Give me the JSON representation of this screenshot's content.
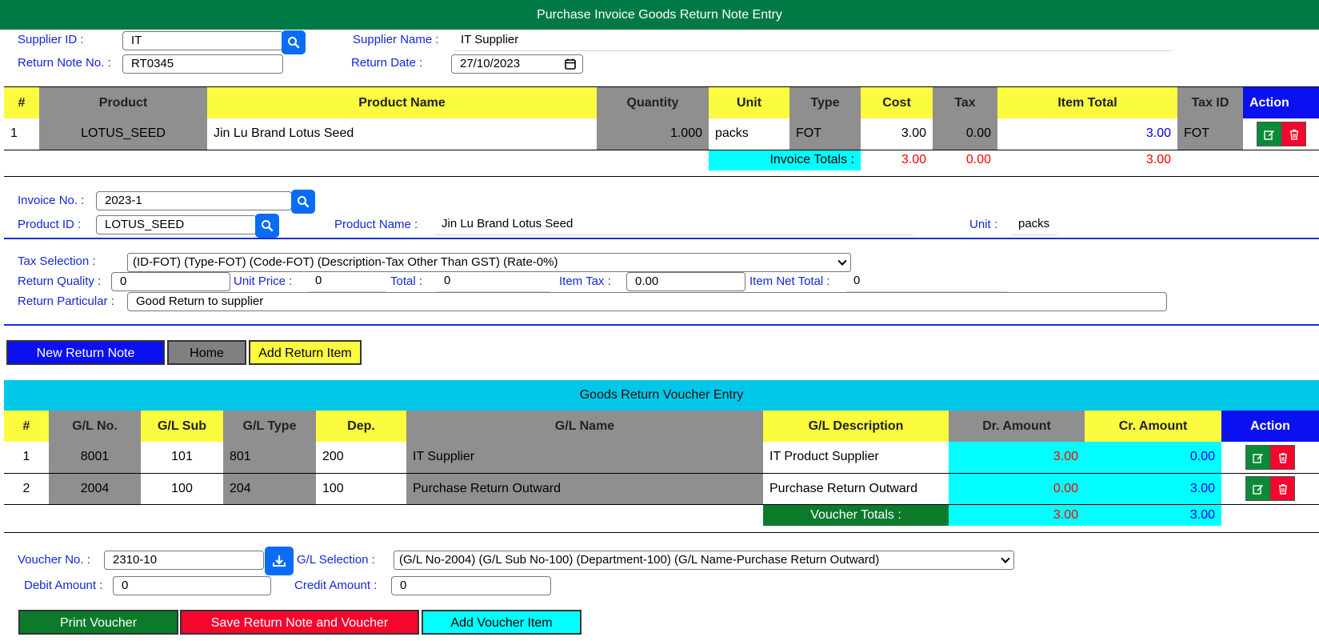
{
  "title": "Purchase Invoice Goods Return Note Entry",
  "header": {
    "supplier_id_label": "Supplier ID :",
    "supplier_id_value": "IT",
    "supplier_name_label": "Supplier Name :",
    "supplier_name_value": "IT Supplier",
    "return_note_label": "Return Note No. :",
    "return_note_value": "RT0345",
    "return_date_label": "Return Date :",
    "return_date_value": "27/10/2023"
  },
  "items_table": {
    "headers": [
      "#",
      "Product",
      "Product Name",
      "Quantity",
      "Unit",
      "Type",
      "Cost",
      "Tax",
      "Item Total",
      "Tax ID",
      "Action"
    ],
    "rows": [
      {
        "no": "1",
        "product": "LOTUS_SEED",
        "product_name": "Jin Lu Brand Lotus Seed",
        "quantity": "1.000",
        "unit": "packs",
        "type": "FOT",
        "cost": "3.00",
        "tax": "0.00",
        "item_total": "3.00",
        "tax_id": "FOT"
      }
    ],
    "totals_label": "Invoice Totals :",
    "total_cost": "3.00",
    "total_tax": "0.00",
    "total_item": "3.00"
  },
  "item_form": {
    "invoice_label": "Invoice No. :",
    "invoice_value": "2023-1",
    "product_id_label": "Product ID :",
    "product_id_value": "LOTUS_SEED",
    "product_name_label": "Product Name :",
    "product_name_value": "Jin Lu Brand Lotus Seed",
    "unit_label": "Unit :",
    "unit_value": "packs",
    "tax_selection_label": "Tax Selection :",
    "tax_selection_value": "(ID-FOT) (Type-FOT) (Code-FOT) (Description-Tax Other Than GST) (Rate-0%)",
    "return_quality_label": "Return Quality :",
    "return_quality_value": "0",
    "unit_price_label": "Unit Price :",
    "unit_price_value": "0",
    "total_label": "Total :",
    "total_value": "0",
    "item_tax_label": "Item Tax :",
    "item_tax_value": "0.00",
    "item_net_total_label": "Item Net Total :",
    "item_net_total_value": "0",
    "return_particular_label": "Return Particular :",
    "return_particular_value": "Good Return to supplier"
  },
  "buttons": {
    "new_return_note": "New Return Note",
    "home": "Home",
    "add_return_item": "Add Return Item",
    "print_voucher": "Print Voucher",
    "save_return": "Save Return Note and Voucher",
    "add_voucher_item": "Add Voucher Item"
  },
  "voucher_section_title": "Goods Return Voucher Entry",
  "voucher_table": {
    "headers": [
      "#",
      "G/L No.",
      "G/L Sub",
      "G/L Type",
      "Dep.",
      "G/L Name",
      "G/L Description",
      "Dr. Amount",
      "Cr. Amount",
      "Action"
    ],
    "rows": [
      {
        "no": "1",
        "gl_no": "8001",
        "gl_sub": "101",
        "gl_type": "801",
        "dep": "200",
        "gl_name": "IT Supplier",
        "gl_desc": "IT Product Supplier",
        "dr": "3.00",
        "cr": "0.00"
      },
      {
        "no": "2",
        "gl_no": "2004",
        "gl_sub": "100",
        "gl_type": "204",
        "dep": "100",
        "gl_name": "Purchase Return Outward",
        "gl_desc": "Purchase Return Outward",
        "dr": "0.00",
        "cr": "3.00"
      }
    ],
    "totals_label": "Voucher Totals :",
    "total_dr": "3.00",
    "total_cr": "3.00"
  },
  "voucher_form": {
    "voucher_no_label": "Voucher No. :",
    "voucher_no_value": "2310-10",
    "gl_selection_label": "G/L Selection :",
    "gl_selection_value": "(G/L No-2004) (G/L Sub No-100) (Department-100) (G/L Name-Purchase Return Outward)",
    "debit_label": "Debit Amount :",
    "debit_value": "0",
    "credit_label": "Credit Amount :",
    "credit_value": "0"
  },
  "colors": {
    "title_bar": "#007a45",
    "label_blue": "#1428d4",
    "header_yellow": "#fbfb3f",
    "header_grey": "#8f8f8f",
    "action_blue": "#0a10f2",
    "cyan": "#00ffff",
    "section_cyan": "#00c7e8",
    "print_green": "#0b7a2b",
    "save_red": "#f5062c"
  },
  "icons": [
    "search-icon",
    "calendar-icon",
    "edit-icon",
    "trash-icon",
    "download-icon",
    "chevron-down-icon"
  ]
}
